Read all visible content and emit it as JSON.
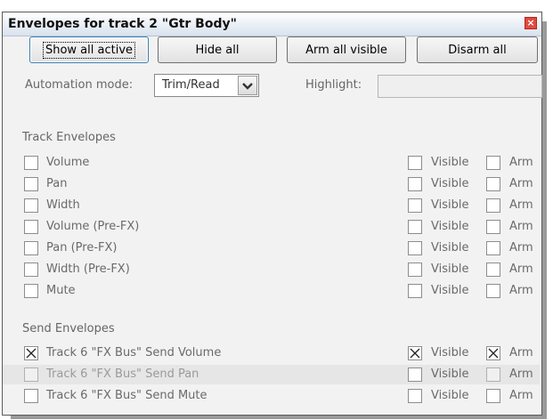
{
  "dialog": {
    "title": "Envelopes for track 2 \"Gtr Body\"",
    "close_glyph": "×"
  },
  "toolbar": {
    "show_all_active": "Show all active",
    "hide_all": "Hide all",
    "arm_all_visible": "Arm all visible",
    "disarm_all": "Disarm all"
  },
  "automation": {
    "label": "Automation mode:",
    "value": "Trim/Read",
    "highlight_label": "Highlight:",
    "highlight_value": ""
  },
  "track_envelopes": {
    "heading": "Track Envelopes",
    "items": [
      {
        "label": "Volume",
        "checked": false,
        "visible": false,
        "arm": false
      },
      {
        "label": "Pan",
        "checked": false,
        "visible": false,
        "arm": false
      },
      {
        "label": "Width",
        "checked": false,
        "visible": false,
        "arm": false
      },
      {
        "label": "Volume (Pre-FX)",
        "checked": false,
        "visible": false,
        "arm": false
      },
      {
        "label": "Pan (Pre-FX)",
        "checked": false,
        "visible": false,
        "arm": false
      },
      {
        "label": "Width (Pre-FX)",
        "checked": false,
        "visible": false,
        "arm": false
      },
      {
        "label": "Mute",
        "checked": false,
        "visible": false,
        "arm": false
      }
    ]
  },
  "send_envelopes": {
    "heading": "Send Envelopes",
    "items": [
      {
        "label": "Track 6 \"FX Bus\" Send Volume",
        "checked": true,
        "visible": true,
        "arm": true
      },
      {
        "label": "Track 6 \"FX Bus\" Send Pan",
        "checked": false,
        "visible": false,
        "arm": false
      },
      {
        "label": "Track 6 \"FX Bus\" Send Mute",
        "checked": false,
        "visible": false,
        "arm": false
      }
    ]
  },
  "labels": {
    "visible": "Visible",
    "arm": "Arm"
  }
}
